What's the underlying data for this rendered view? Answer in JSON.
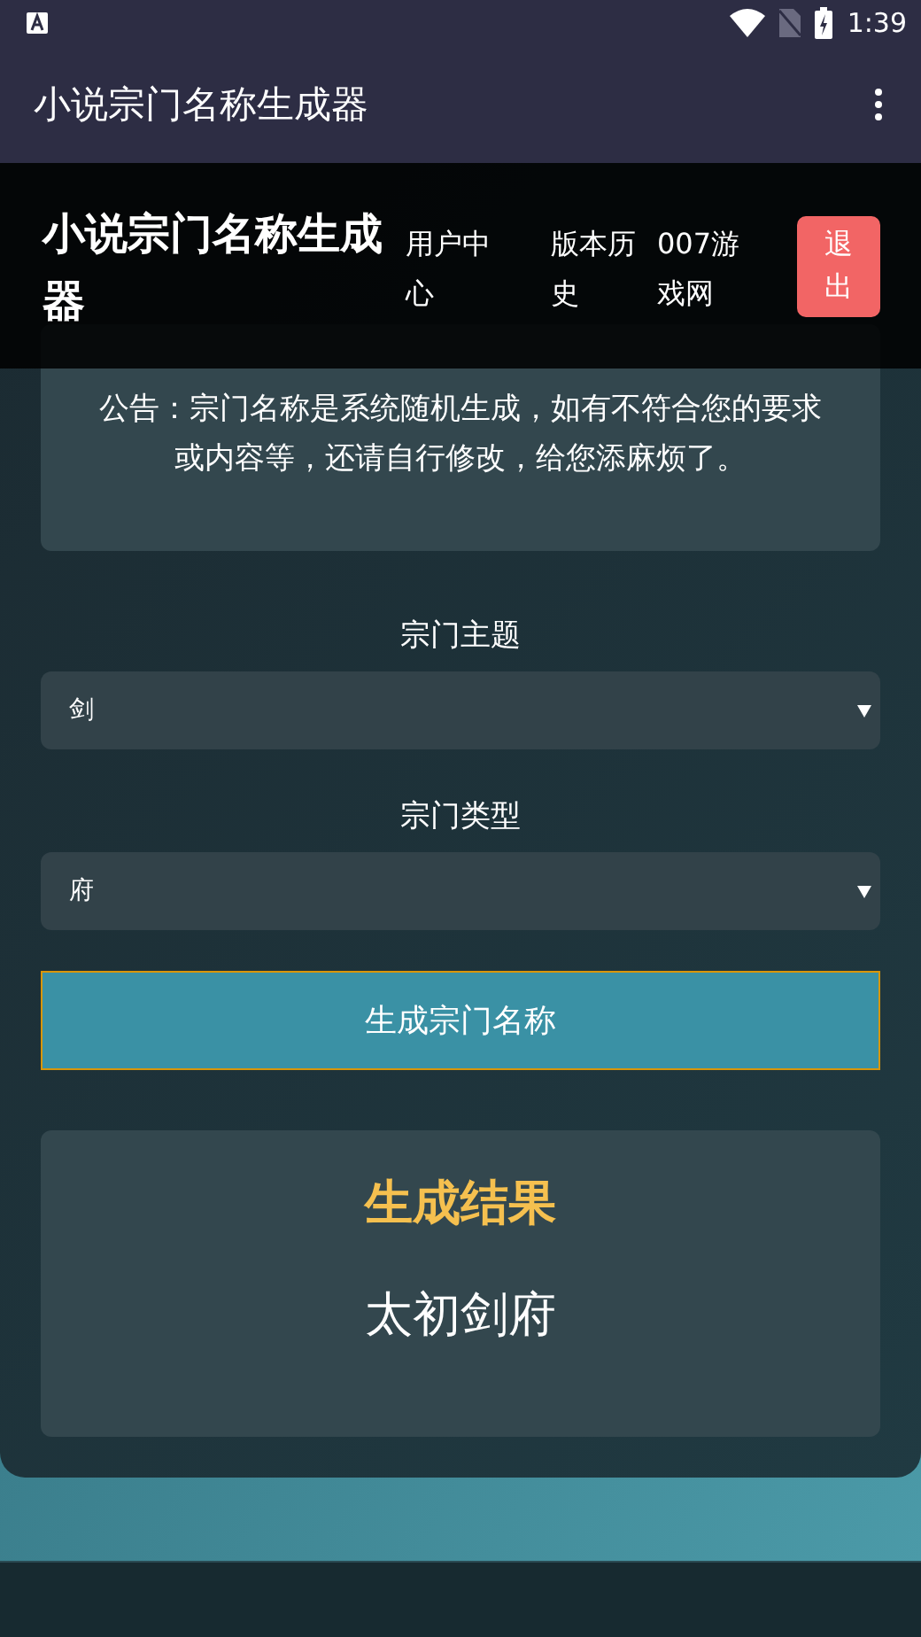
{
  "status_bar": {
    "time": "1:39"
  },
  "app_bar": {
    "title": "小说宗门名称生成器"
  },
  "site_header": {
    "title": "小说宗门名称生成器",
    "nav": [
      "用户中心",
      "版本历史",
      "007游戏网"
    ],
    "logout": "退出"
  },
  "notice": "公告：宗门名称是系统随机生成，如有不符合您的要求或内容等，还请自行修改，给您添麻烦了。",
  "fields": [
    {
      "label": "宗门主题",
      "value": "剑"
    },
    {
      "label": "宗门类型",
      "value": "府"
    }
  ],
  "generate_button": "生成宗门名称",
  "result": {
    "title": "生成结果",
    "name": "太初剑府"
  }
}
